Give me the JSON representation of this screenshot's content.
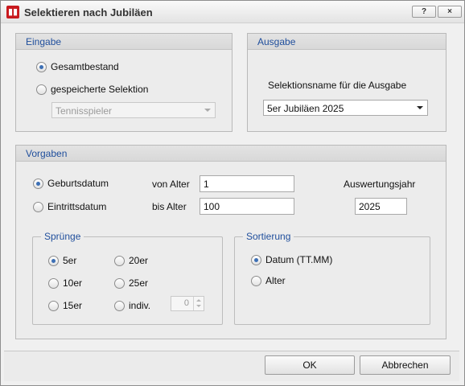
{
  "window": {
    "title": "Selektieren nach Jubiläen",
    "help_label": "?",
    "close_label": "×"
  },
  "eingabe": {
    "title": "Eingabe",
    "options": [
      {
        "label": "Gesamtbestand",
        "selected": true
      },
      {
        "label": "gespeicherte Selektion",
        "selected": false
      }
    ],
    "selection_combo": "Tennisspieler"
  },
  "ausgabe": {
    "title": "Ausgabe",
    "name_label": "Selektionsname für die Ausgabe",
    "name_value": "5er Jubiläen 2025"
  },
  "vorgaben": {
    "title": "Vorgaben",
    "date_options": [
      {
        "label": "Geburtsdatum",
        "selected": true
      },
      {
        "label": "Eintrittsdatum",
        "selected": false
      }
    ],
    "von_alter_label": "von Alter",
    "von_alter_value": "1",
    "bis_alter_label": "bis Alter",
    "bis_alter_value": "100",
    "year_label": "Auswertungsjahr",
    "year_value": "2025",
    "spruenge": {
      "title": "Sprünge",
      "options": [
        {
          "label": "5er",
          "selected": true
        },
        {
          "label": "20er",
          "selected": false
        },
        {
          "label": "10er",
          "selected": false
        },
        {
          "label": "25er",
          "selected": false
        },
        {
          "label": "15er",
          "selected": false
        },
        {
          "label": "indiv.",
          "selected": false
        }
      ],
      "indiv_value": "0"
    },
    "sortierung": {
      "title": "Sortierung",
      "options": [
        {
          "label": "Datum (TT.MM)",
          "selected": true
        },
        {
          "label": "Alter",
          "selected": false
        }
      ]
    }
  },
  "buttons": {
    "ok": "OK",
    "cancel": "Abbrechen"
  }
}
